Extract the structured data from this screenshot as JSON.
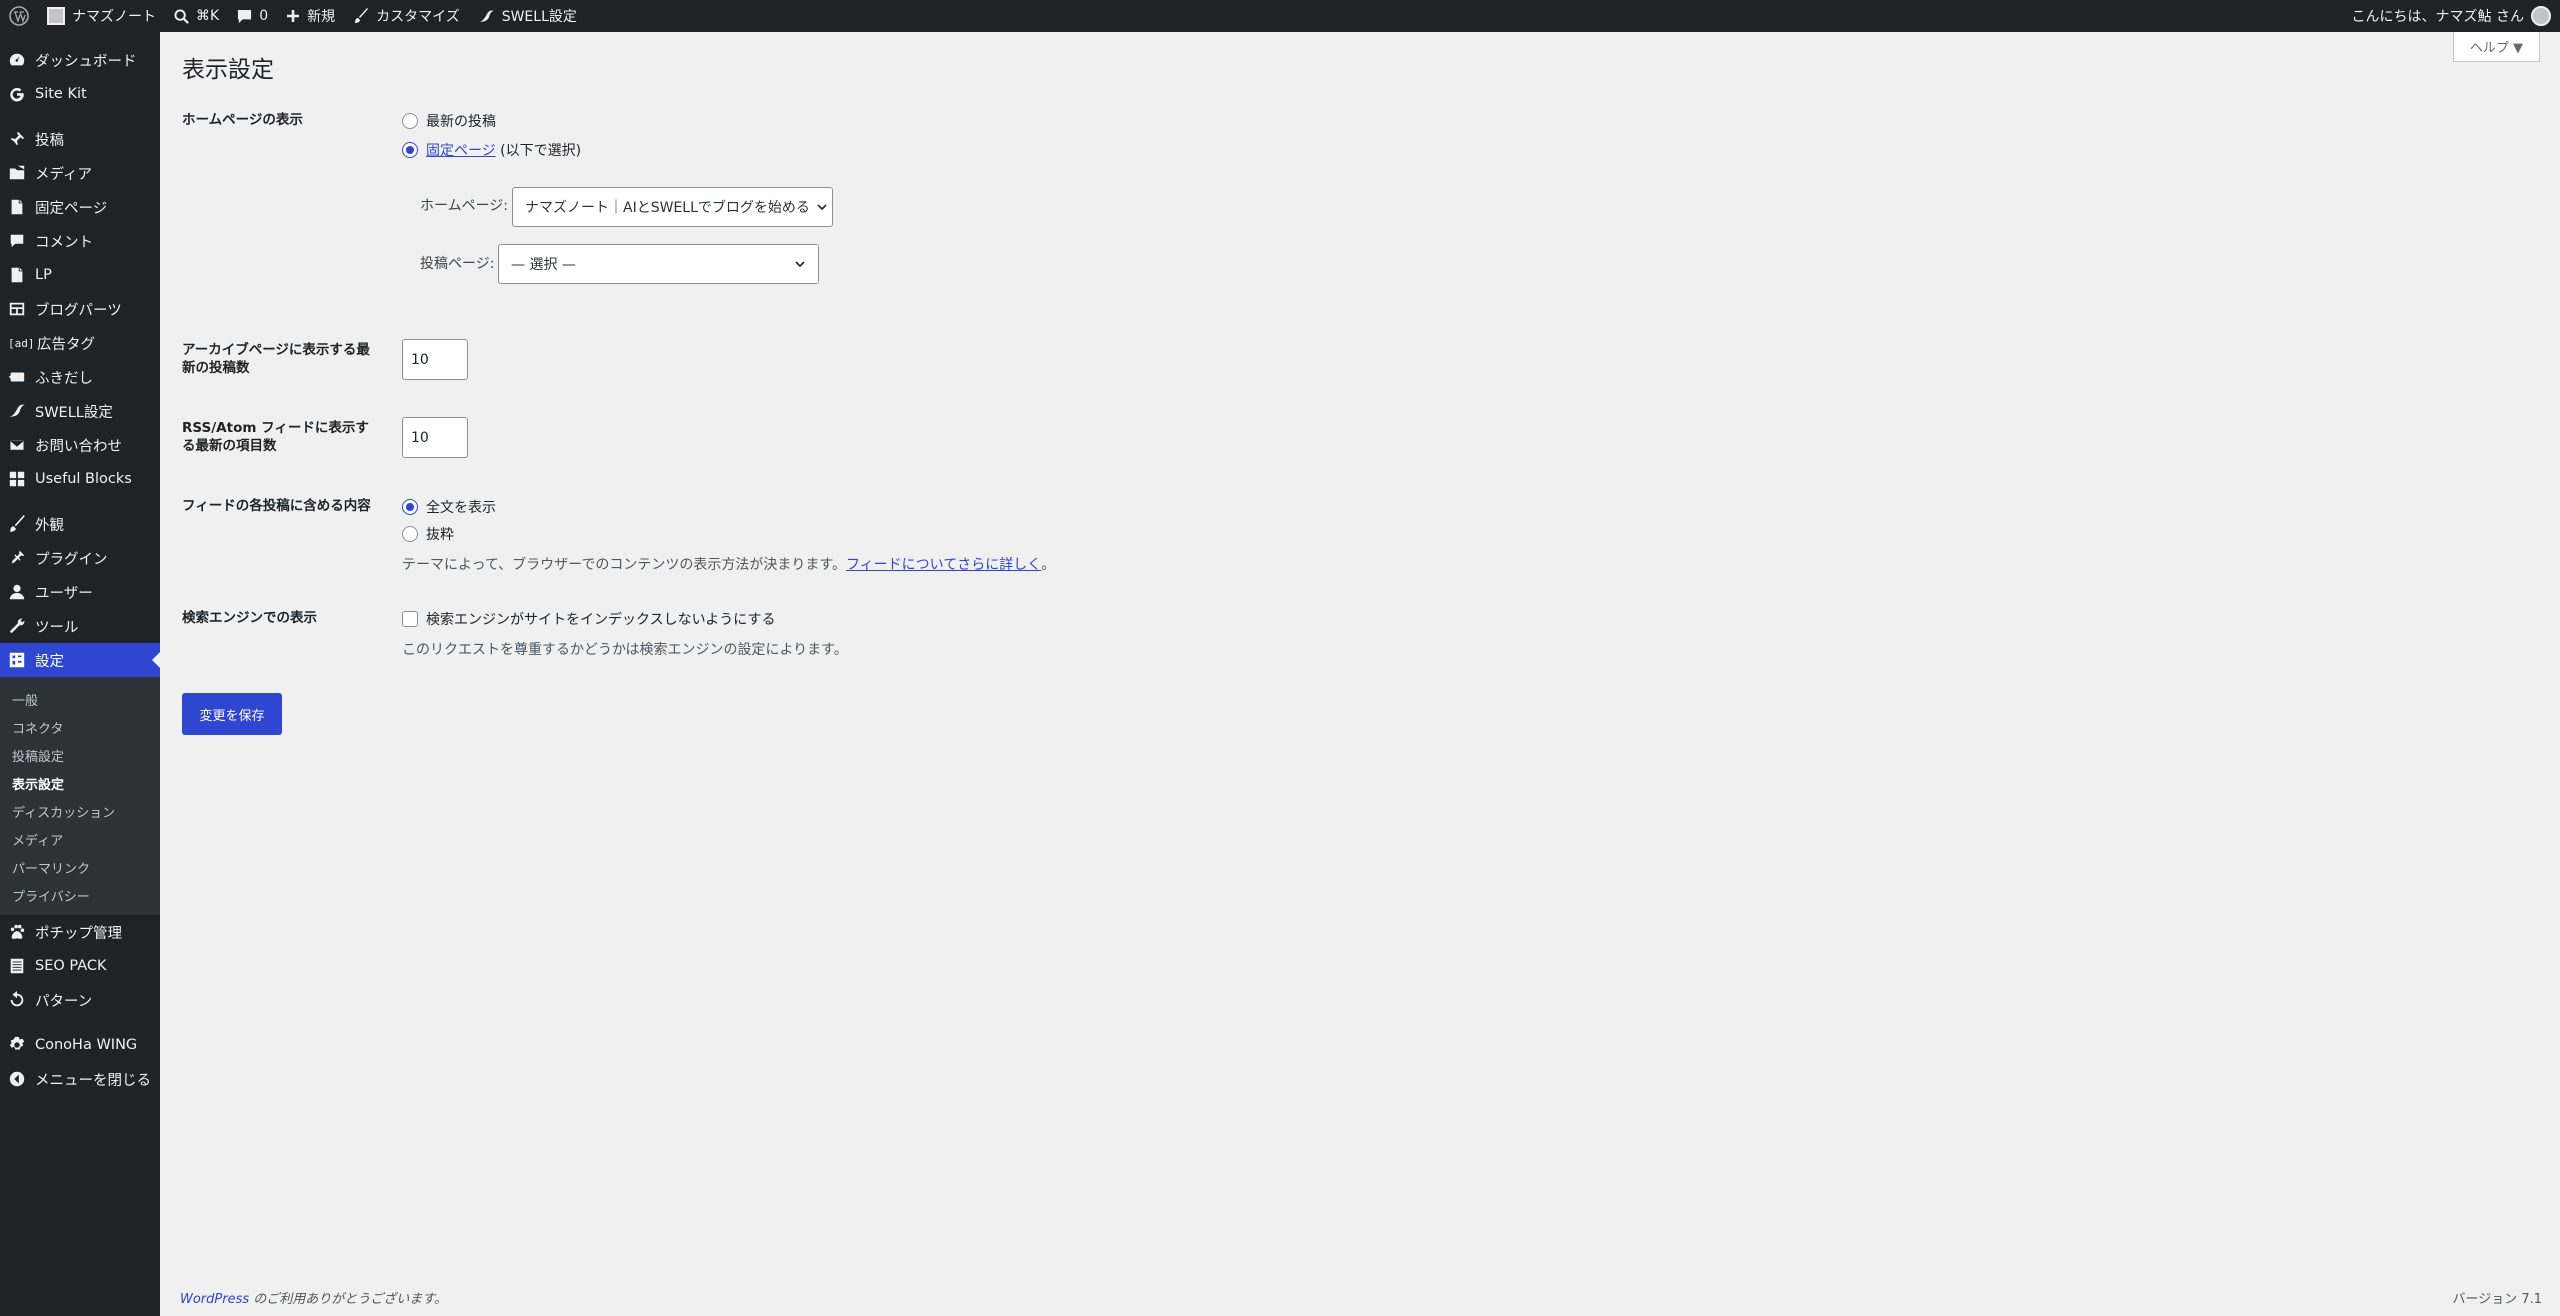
{
  "adminbar": {
    "site_name": "ナマズノート",
    "search_shortcut": "⌘K",
    "comments_count": "0",
    "new_label": "新規",
    "customize_label": "カスタマイズ",
    "swell_label": "SWELL設定",
    "greeting": "こんにちは、ナマズ鮎 さん"
  },
  "sidebar": {
    "items": [
      {
        "label": "ダッシュボード",
        "icon": "dashboard-icon"
      },
      {
        "label": "Site Kit",
        "icon": "google-g-icon"
      },
      {
        "label": "投稿",
        "icon": "pin-icon"
      },
      {
        "label": "メディア",
        "icon": "media-icon"
      },
      {
        "label": "固定ページ",
        "icon": "page-icon"
      },
      {
        "label": "コメント",
        "icon": "comment-icon"
      },
      {
        "label": "LP",
        "icon": "page-icon"
      },
      {
        "label": "ブログパーツ",
        "icon": "blocks-icon"
      },
      {
        "label": "広告タグ",
        "icon": "ad-icon"
      },
      {
        "label": "ふきだし",
        "icon": "bubble-icon"
      },
      {
        "label": "SWELL設定",
        "icon": "swell-icon"
      },
      {
        "label": "お問い合わせ",
        "icon": "mail-icon"
      },
      {
        "label": "Useful Blocks",
        "icon": "grid-icon"
      },
      {
        "label": "外観",
        "icon": "brush-icon"
      },
      {
        "label": "プラグイン",
        "icon": "plugin-icon"
      },
      {
        "label": "ユーザー",
        "icon": "user-icon"
      },
      {
        "label": "ツール",
        "icon": "wrench-icon"
      },
      {
        "label": "設定",
        "icon": "settings-icon"
      },
      {
        "label": "ポチップ管理",
        "icon": "paw-icon"
      },
      {
        "label": "SEO PACK",
        "icon": "list-icon"
      },
      {
        "label": "パターン",
        "icon": "undo-icon"
      },
      {
        "label": "ConoHa WING",
        "icon": "gear-icon"
      },
      {
        "label": "メニューを閉じる",
        "icon": "collapse-icon"
      }
    ],
    "submenu": [
      "一般",
      "コネクタ",
      "投稿設定",
      "表示設定",
      "ディスカッション",
      "メディア",
      "パーマリンク",
      "プライバシー"
    ]
  },
  "page": {
    "title": "表示設定",
    "help": "ヘルプ ▼",
    "homepage_display_label": "ホームページの表示",
    "radio_latest": "最新の投稿",
    "radio_static_link": "固定ページ",
    "radio_static_suffix": " (以下で選択)",
    "homepage_label": "ホームページ:",
    "homepage_value": "ナマズノート｜AIとSWELLでブログを始める",
    "postspage_label": "投稿ページ:",
    "postspage_value": "— 選択 —",
    "archive_label": "アーカイブページに表示する最新の投稿数",
    "archive_value": "10",
    "rss_label": "RSS/Atom フィードに表示する最新の項目数",
    "rss_value": "10",
    "feed_label": "フィードの各投稿に含める内容",
    "feed_full": "全文を表示",
    "feed_excerpt": "抜粋",
    "feed_desc": "テーマによって、ブラウザーでのコンテンツの表示方法が決まります。",
    "feed_desc_link": "フィードについてさらに詳しく",
    "feed_desc_end": "。",
    "search_label": "検索エンジンでの表示",
    "search_checkbox": "検索エンジンがサイトをインデックスしないようにする",
    "search_desc": "このリクエストを尊重するかどうかは検索エンジンの設定によります。",
    "save_label": "変更を保存"
  },
  "footer": {
    "wp_link": "WordPress",
    "thanks": " のご利用ありがとうございます。",
    "version": "バージョン 7.1"
  }
}
